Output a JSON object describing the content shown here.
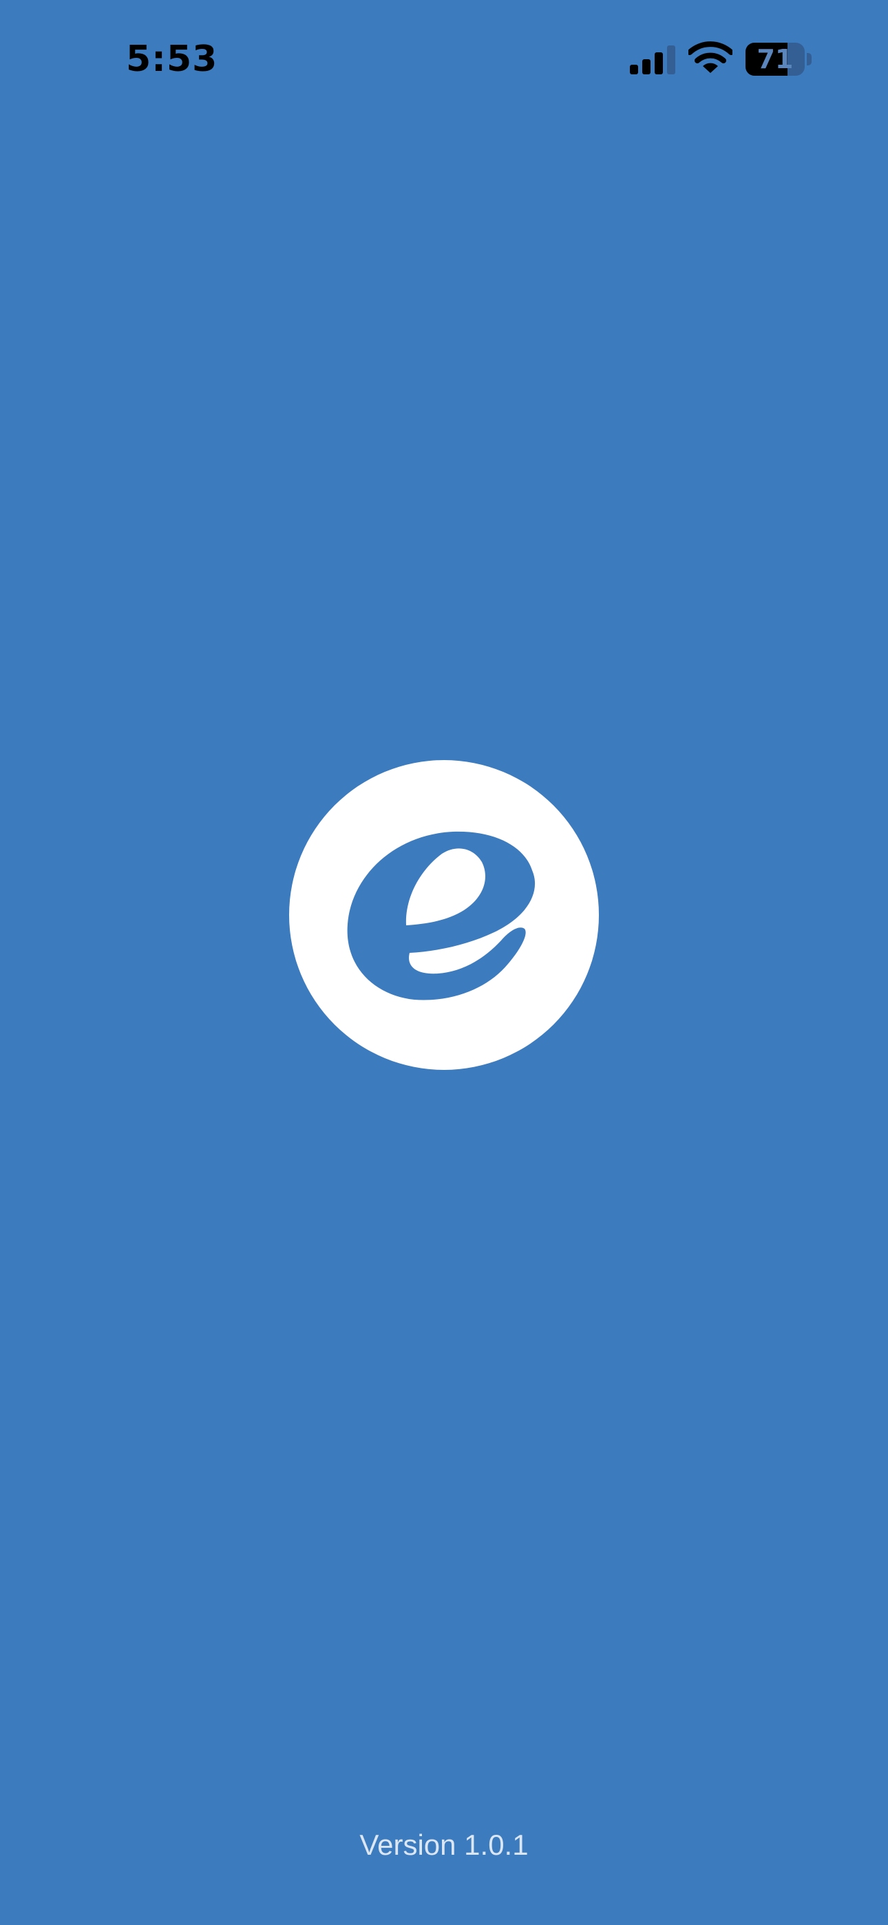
{
  "status_bar": {
    "time": "5:53",
    "battery_level": "71",
    "battery_fraction": 0.71,
    "signal_icon": "cellular-signal-icon",
    "wifi_icon": "wifi-icon",
    "battery_icon": "battery-icon"
  },
  "splash": {
    "logo_icon": "e-letter-logo-icon",
    "version": "Version 1.0.1"
  },
  "colors": {
    "background": "#3d7bbf",
    "logo_circle": "#ffffff",
    "logo_letter": "#3d7bbf",
    "version_text": "#dbe6f3",
    "status_text": "#000000"
  }
}
